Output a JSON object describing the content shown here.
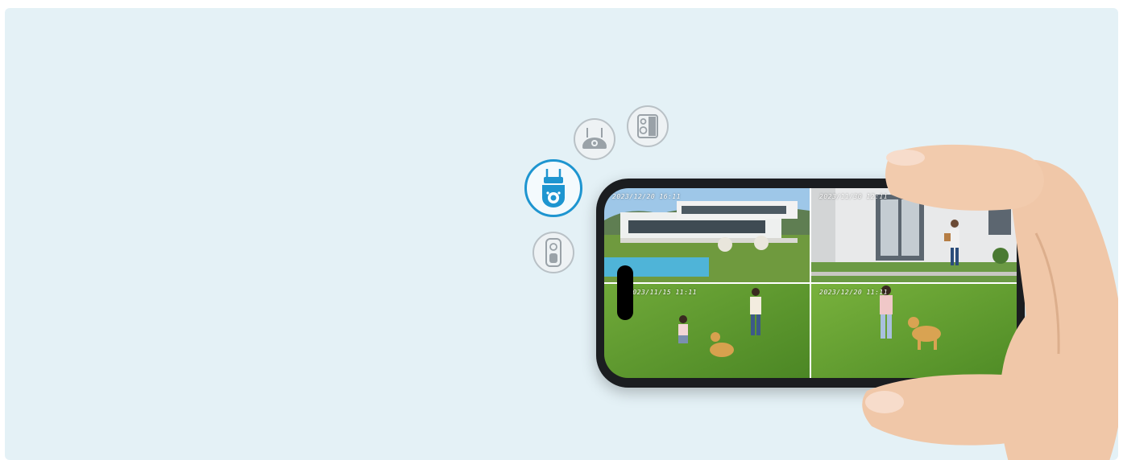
{
  "colors": {
    "background": "#e4f1f6",
    "accent": "#1e95d0",
    "icon_inactive": "#9aa2a8"
  },
  "camera_icons": [
    {
      "icon": "ptz-camera-icon",
      "state": "selected"
    },
    {
      "icon": "floodlight-camera-icon",
      "state": "inactive"
    },
    {
      "icon": "speaker-camera-icon",
      "state": "inactive"
    },
    {
      "icon": "doorbell-camera-icon",
      "state": "inactive"
    }
  ],
  "feeds": [
    {
      "timestamp": "2023/12/20  16:11"
    },
    {
      "timestamp": "2023/11/30  12:11"
    },
    {
      "timestamp": "2023/11/15  11:11"
    },
    {
      "timestamp": "2023/12/20  11:11"
    }
  ]
}
